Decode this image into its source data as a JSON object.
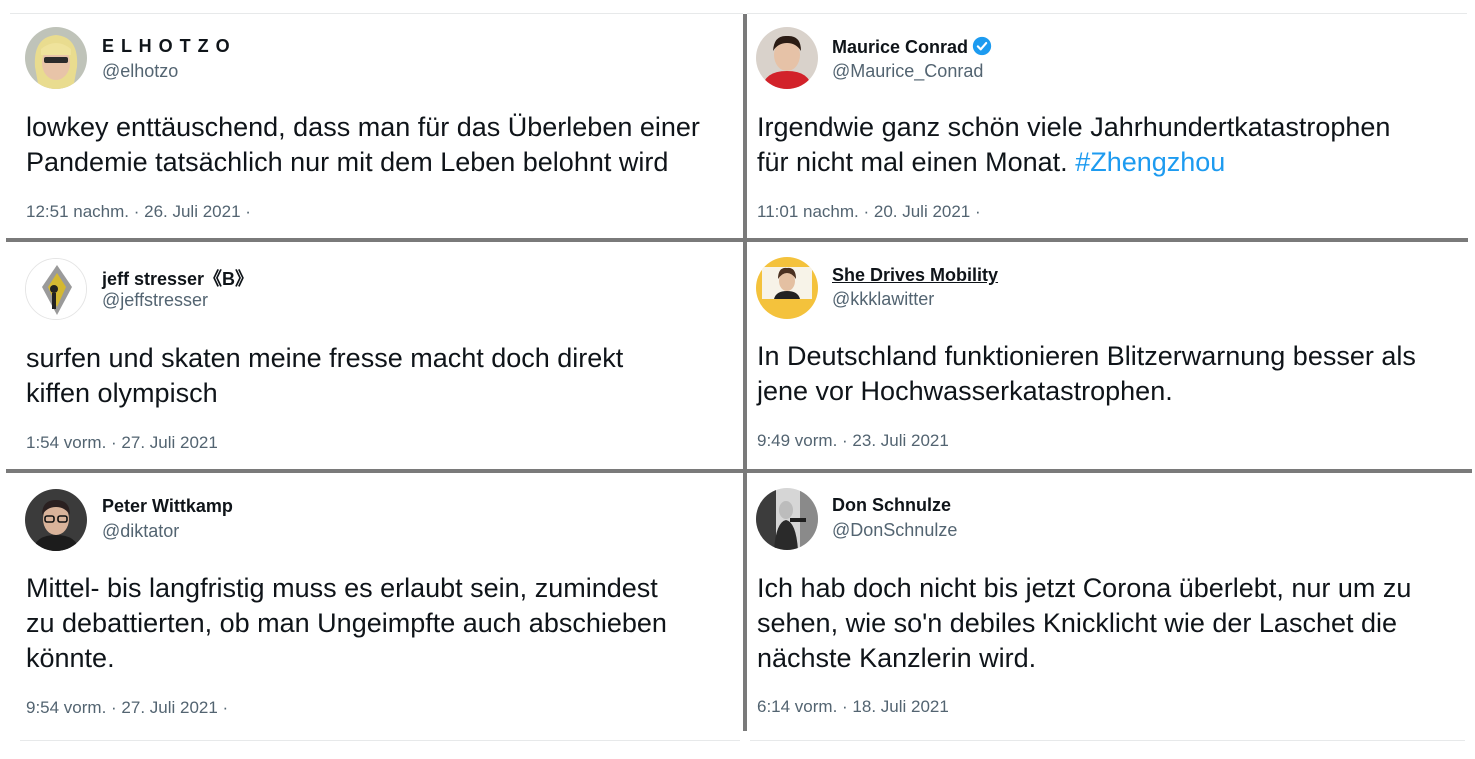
{
  "tweets": [
    {
      "name": "E L H O T Z O",
      "handle": "@elhotzo",
      "avatar": "blond-person-avatar",
      "lines": [
        "lowkey enttäuschend, dass man für das Überleben einer",
        "Pandemie tatsächlich nur mit dem Leben belohnt wird"
      ],
      "timestamp": "12:51 nachm. · 26. Juli 2021 ·"
    },
    {
      "name": "Maurice Conrad",
      "handle": "@Maurice_Conrad",
      "avatar": "young-man-red-shirt-avatar",
      "verified": true,
      "lines": [
        "Irgendwie ganz schön viele Jahrhundertkatastrophen",
        "für nicht mal einen Monat."
      ],
      "hashtag": "#Zhengzhou",
      "timestamp": "11:01 nachm. · 20. Juli 2021 ·"
    },
    {
      "name": "jeff stresser《B》",
      "handle": "@jeffstresser",
      "avatar": "diamond-figure-avatar",
      "lines": [
        "surfen und skaten meine fresse macht doch direkt",
        "kiffen olympisch"
      ],
      "timestamp": "1:54 vorm. · 27. Juli 2021"
    },
    {
      "name": "She Drives Mobility",
      "handle": "@kkklawitter",
      "avatar": "woman-yellow-background-avatar",
      "lines": [
        "In Deutschland funktionieren Blitzerwarnung besser als",
        "jene vor Hochwasserkatastrophen."
      ],
      "timestamp": "9:49 vorm. · 23. Juli 2021"
    },
    {
      "name": "Peter Wittkamp",
      "handle": "@diktator",
      "avatar": "man-glasses-avatar",
      "lines": [
        "Mittel- bis langfristig muss es erlaubt sein, zumindest",
        "zu debattierten, ob man Ungeimpfte auch abschieben",
        "könnte."
      ],
      "timestamp": "9:54 vorm. · 27. Juli 2021 ·"
    },
    {
      "name": "Don Schnulze",
      "handle": "@DonSchnulze",
      "avatar": "grayscale-photo-avatar",
      "lines": [
        "Ich hab doch nicht bis jetzt Corona überlebt, nur um zu",
        "sehen, wie so'n debiles Knicklicht wie der Laschet die",
        "nächste Kanzlerin wird."
      ],
      "timestamp": "6:14 vorm. · 18. Juli 2021"
    }
  ],
  "colors": {
    "text": "#0f1419",
    "secondary": "#536471",
    "link": "#1d9bf0",
    "divider": "#7a7a7a"
  }
}
